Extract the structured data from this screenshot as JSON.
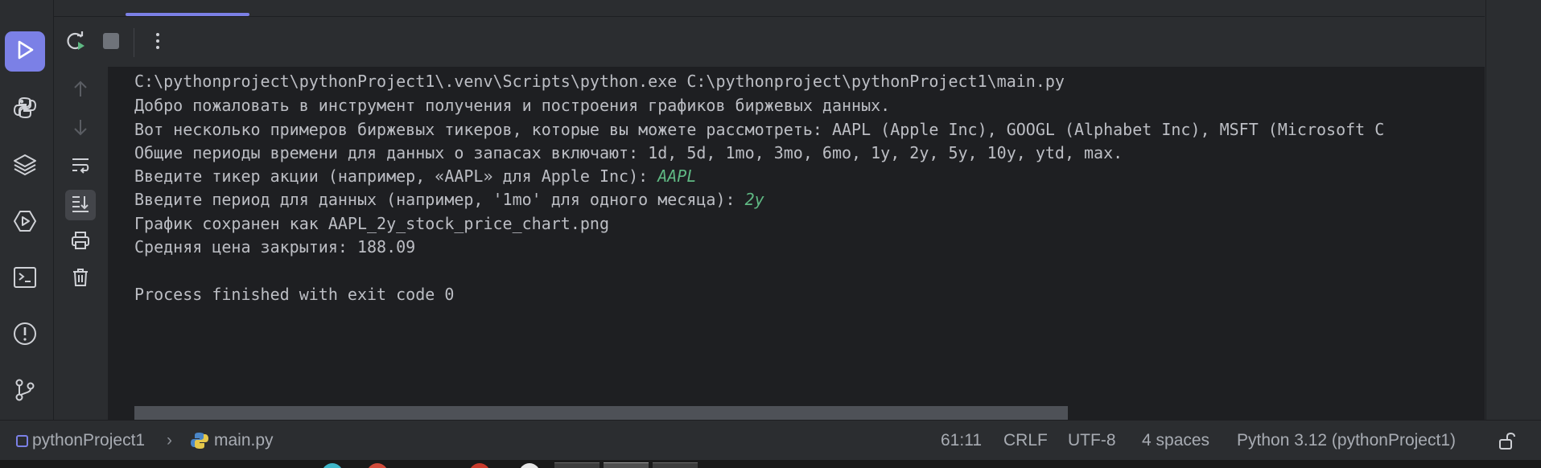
{
  "left_bar": {
    "items": [
      {
        "icon": "run-icon",
        "active": true
      },
      {
        "icon": "python-console-icon"
      },
      {
        "icon": "layers-icon"
      },
      {
        "icon": "services-icon"
      },
      {
        "icon": "terminal-icon"
      },
      {
        "icon": "problems-icon"
      },
      {
        "icon": "git-icon"
      }
    ]
  },
  "toolbar": {
    "rerun_icon": "rerun-icon",
    "stop_icon": "stop-icon",
    "more_icon": "more-vertical-icon"
  },
  "console": {
    "lines": [
      "C:\\pythonproject\\pythonProject1\\.venv\\Scripts\\python.exe C:\\pythonproject\\pythonProject1\\main.py",
      "Добро пожаловать в инструмент получения и построения графиков биржевых данных.",
      "Вот несколько примеров биржевых тикеров, которые вы можете рассмотреть: AAPL (Apple Inc), GOOGL (Alphabet Inc), MSFT (Microsoft C",
      "Общие периоды времени для данных о запасах включают: 1d, 5d, 1mo, 3mo, 6mo, 1y, 2y, 5y, 10y, ytd, max.",
      "Введите тикер акции (например, «AAPL» для Apple Inc): ",
      "Введите период для данных (например, '1mo' для одного месяца): ",
      "График сохранен как AAPL_2y_stock_price_chart.png",
      "Средняя цена закрытия: 188.09",
      "",
      "Process finished with exit code 0"
    ],
    "input_ticker": "AAPL",
    "input_period": "2y"
  },
  "status_bar": {
    "project": "pythonProject1",
    "file": "main.py",
    "position": "61:11",
    "line_ending": "CRLF",
    "encoding": "UTF-8",
    "indent": "4 spaces",
    "interpreter": "Python 3.12 (pythonProject1)"
  },
  "colors": {
    "accent": "#7b80e6",
    "input_text": "#5fb883",
    "console_bg": "#1e1f22",
    "text": "#bcbec4"
  }
}
